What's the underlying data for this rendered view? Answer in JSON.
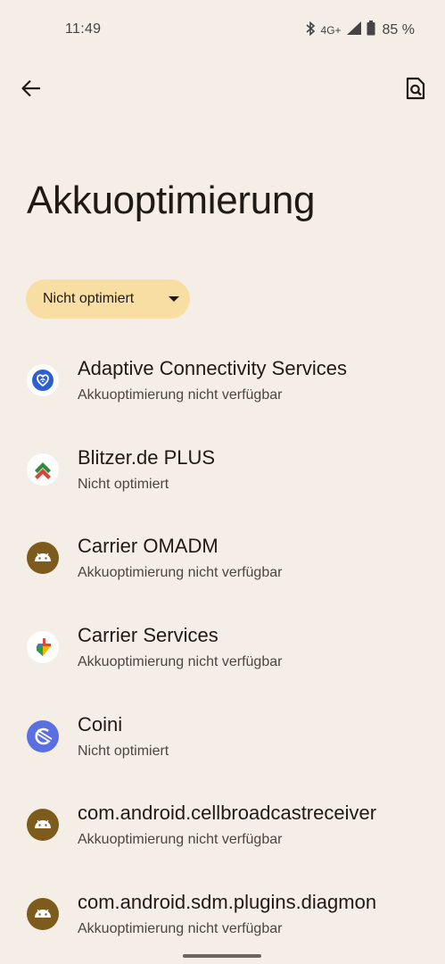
{
  "status_bar": {
    "time": "11:49",
    "network": "4G+",
    "battery": "85 %",
    "icons": [
      "bluetooth-icon",
      "signal-icon",
      "battery-icon"
    ]
  },
  "toolbar": {
    "back_icon": "arrow-left-icon",
    "search_icon": "search-settings-icon"
  },
  "title": "Akkuoptimierung",
  "filter": {
    "selected": "Nicht optimiert"
  },
  "apps": [
    {
      "name": "Adaptive Connectivity Services",
      "status": "Akkuoptimierung nicht verfügbar",
      "icon": "adaptive-connectivity-icon"
    },
    {
      "name": "Blitzer.de PLUS",
      "status": "Nicht optimiert",
      "icon": "blitzer-icon"
    },
    {
      "name": "Carrier OMADM",
      "status": "Akkuoptimierung nicht verfügbar",
      "icon": "android-icon"
    },
    {
      "name": "Carrier Services",
      "status": "Akkuoptimierung nicht verfügbar",
      "icon": "carrier-services-icon"
    },
    {
      "name": "Coini",
      "status": "Nicht optimiert",
      "icon": "coini-icon"
    },
    {
      "name": "com.android.cellbroadcastreceiver",
      "status": "Akkuoptimierung nicht verfügbar",
      "icon": "android-icon"
    },
    {
      "name": "com.android.sdm.plugins.diagmon",
      "status": "Akkuoptimierung nicht verfügbar",
      "icon": "android-icon"
    }
  ],
  "colors": {
    "background": "#f5eee6",
    "chip": "#f8dea3",
    "android_icon_bg": "#7c5b1c",
    "coini_bg": "#5a6fe0"
  }
}
